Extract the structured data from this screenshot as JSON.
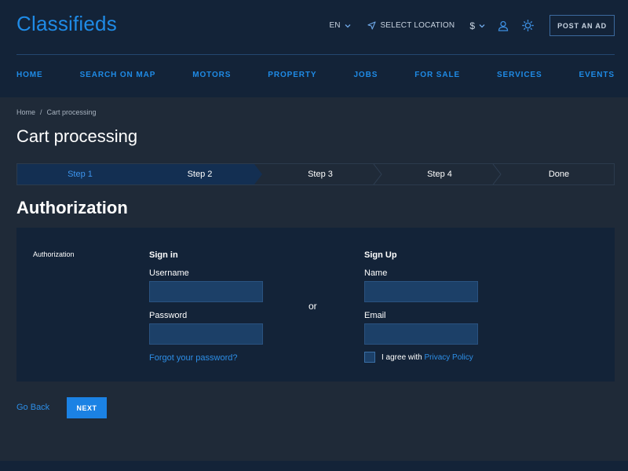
{
  "header": {
    "logo": "Classifieds",
    "language": "EN",
    "location": "SELECT LOCATION",
    "currency": "$",
    "post_ad": "POST AN AD",
    "icons": [
      "chevron-down-icon",
      "location-arrow-icon",
      "user-icon",
      "sun-icon"
    ]
  },
  "nav": {
    "items": [
      "HOME",
      "SEARCH ON MAP",
      "MOTORS",
      "PROPERTY",
      "JOBS",
      "FOR SALE",
      "SERVICES",
      "EVENTS"
    ]
  },
  "breadcrumb": {
    "home": "Home",
    "separator": "/",
    "current": "Cart processing"
  },
  "page_title": "Cart processing",
  "steps": {
    "items": [
      "Step 1",
      "Step 2",
      "Step 3",
      "Step 4",
      "Done"
    ],
    "active_index": 0
  },
  "section_title": "Authorization",
  "auth": {
    "label": "Authorization",
    "sign_in": {
      "title": "Sign in",
      "username_label": "Username",
      "username_value": "",
      "password_label": "Password",
      "password_value": "",
      "forgot": "Forgot your password?"
    },
    "or": "or",
    "sign_up": {
      "title": "Sign Up",
      "name_label": "Name",
      "name_value": "",
      "email_label": "Email",
      "email_value": "",
      "agree_text": "I agree with",
      "privacy_link": "Privacy Policy",
      "agree_checked": false
    }
  },
  "actions": {
    "go_back": "Go Back",
    "next": "NEXT"
  },
  "colors": {
    "accent": "#1f8be6",
    "button": "#1b82e4",
    "header_bg": "#132338",
    "page_bg": "#1f2a38",
    "input_bg": "#1c4068"
  }
}
